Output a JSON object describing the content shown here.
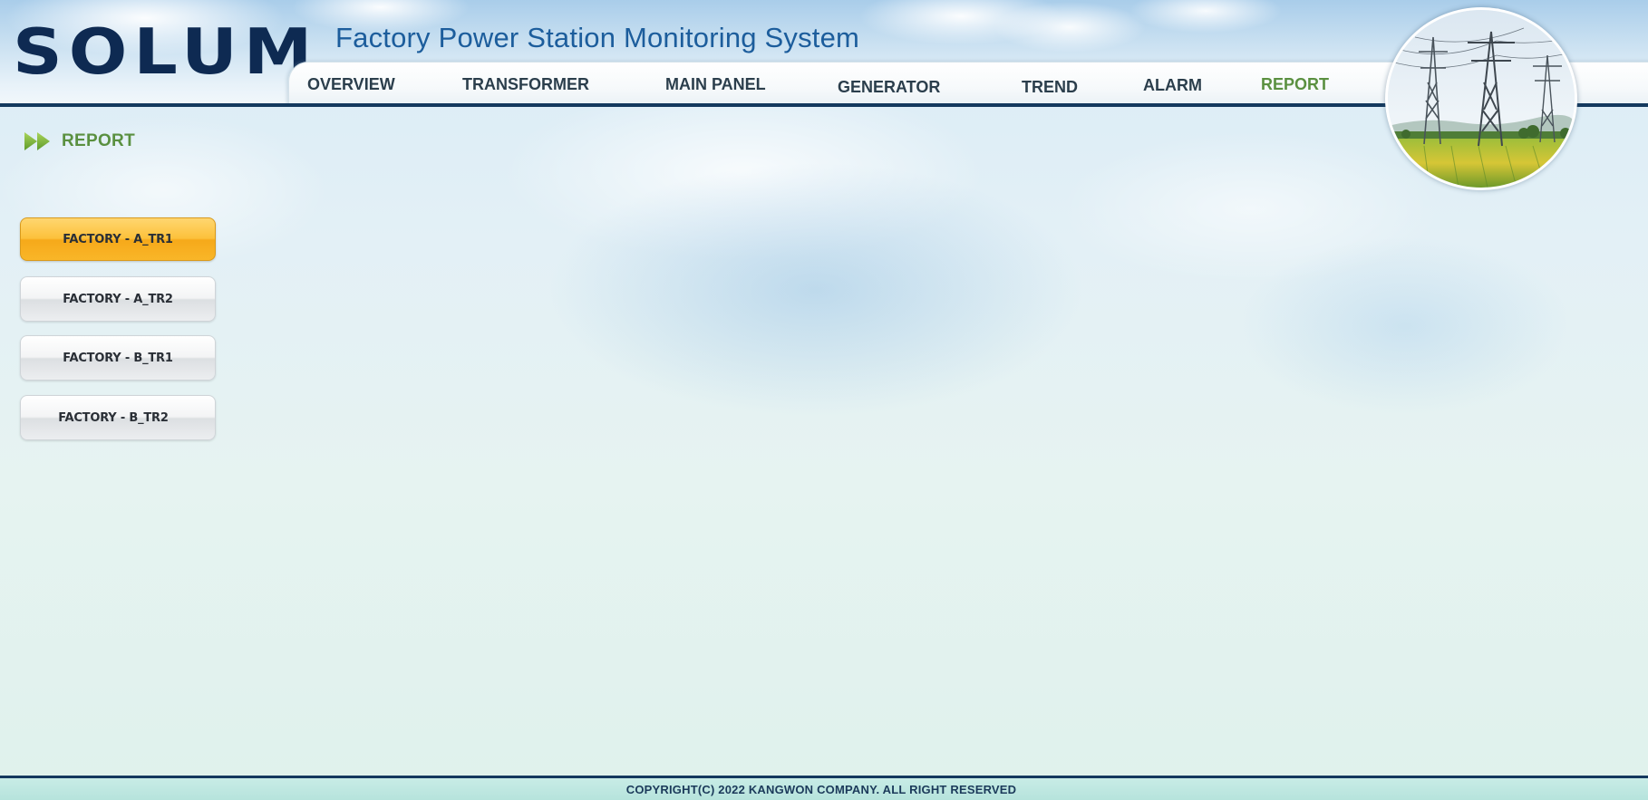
{
  "header": {
    "logo": "SOLUM",
    "app_title": "Factory Power Station Monitoring System"
  },
  "nav": {
    "active": "REPORT",
    "items": [
      {
        "label": "OVERVIEW"
      },
      {
        "label": "TRANSFORMER"
      },
      {
        "label": "MAIN PANEL"
      },
      {
        "label": "GENERATOR"
      },
      {
        "label": "TREND"
      },
      {
        "label": "ALARM"
      },
      {
        "label": "REPORT"
      }
    ]
  },
  "section": {
    "title": "REPORT",
    "icon": "double-arrow-icon"
  },
  "sidebar": {
    "selected": "FACTORY - A_TR1",
    "items": [
      {
        "label": "FACTORY - A_TR1"
      },
      {
        "label": "FACTORY - A_TR2"
      },
      {
        "label": "FACTORY - B_TR1"
      },
      {
        "label": "FACTORY - B_TR2"
      }
    ]
  },
  "footer": {
    "copyright": "COPYRIGHT(C) 2022 KANGWON COMPANY. ALL RIGHT RESERVED"
  },
  "colors": {
    "brand_navy": "#0e2a52",
    "title_blue": "#1c5d9c",
    "nav_text": "#2b3e4c",
    "active_green": "#5a9040",
    "selected_orange": "#fcc13b",
    "footer_bg": "#c8ece6"
  }
}
